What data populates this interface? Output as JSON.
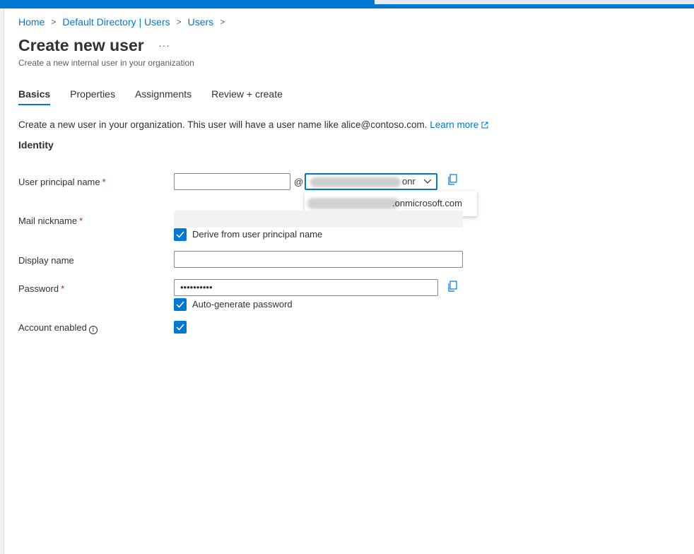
{
  "breadcrumb": [
    {
      "label": "Home"
    },
    {
      "label": "Default Directory | Users"
    },
    {
      "label": "Users"
    }
  ],
  "separator": ">",
  "page": {
    "title": "Create new user",
    "more": "···",
    "subtitle": "Create a new internal user in your organization"
  },
  "tabs": [
    {
      "label": "Basics",
      "active": true
    },
    {
      "label": "Properties",
      "active": false
    },
    {
      "label": "Assignments",
      "active": false
    },
    {
      "label": "Review + create",
      "active": false
    }
  ],
  "intro": {
    "text": "Create a new user in your organization. This user will have a user name like alice@contoso.com.",
    "link": "Learn more"
  },
  "section": "Identity",
  "fields": {
    "upn": {
      "label": "User principal name",
      "required": "*",
      "value": "",
      "at": "@",
      "domain_visible": "onr"
    },
    "domain_option": ".onmicrosoft.com",
    "mail_nickname": {
      "label": "Mail nickname",
      "required": "*",
      "value": ""
    },
    "derive_checkbox": {
      "label": "Derive from user principal name",
      "checked": true
    },
    "display_name": {
      "label": "Display name",
      "value": ""
    },
    "password": {
      "label": "Password",
      "required": "*",
      "value": "••••••••••"
    },
    "autogen_checkbox": {
      "label": "Auto-generate password",
      "checked": true
    },
    "account_enabled": {
      "label": "Account enabled",
      "info": "i",
      "checked": true
    }
  },
  "colors": {
    "accent": "#0078d4",
    "required": "#a4262c"
  },
  "icons": {
    "copy": "copy-icon",
    "chevron": "chevron-down-icon",
    "external": "external-link-icon",
    "info": "info-icon"
  }
}
